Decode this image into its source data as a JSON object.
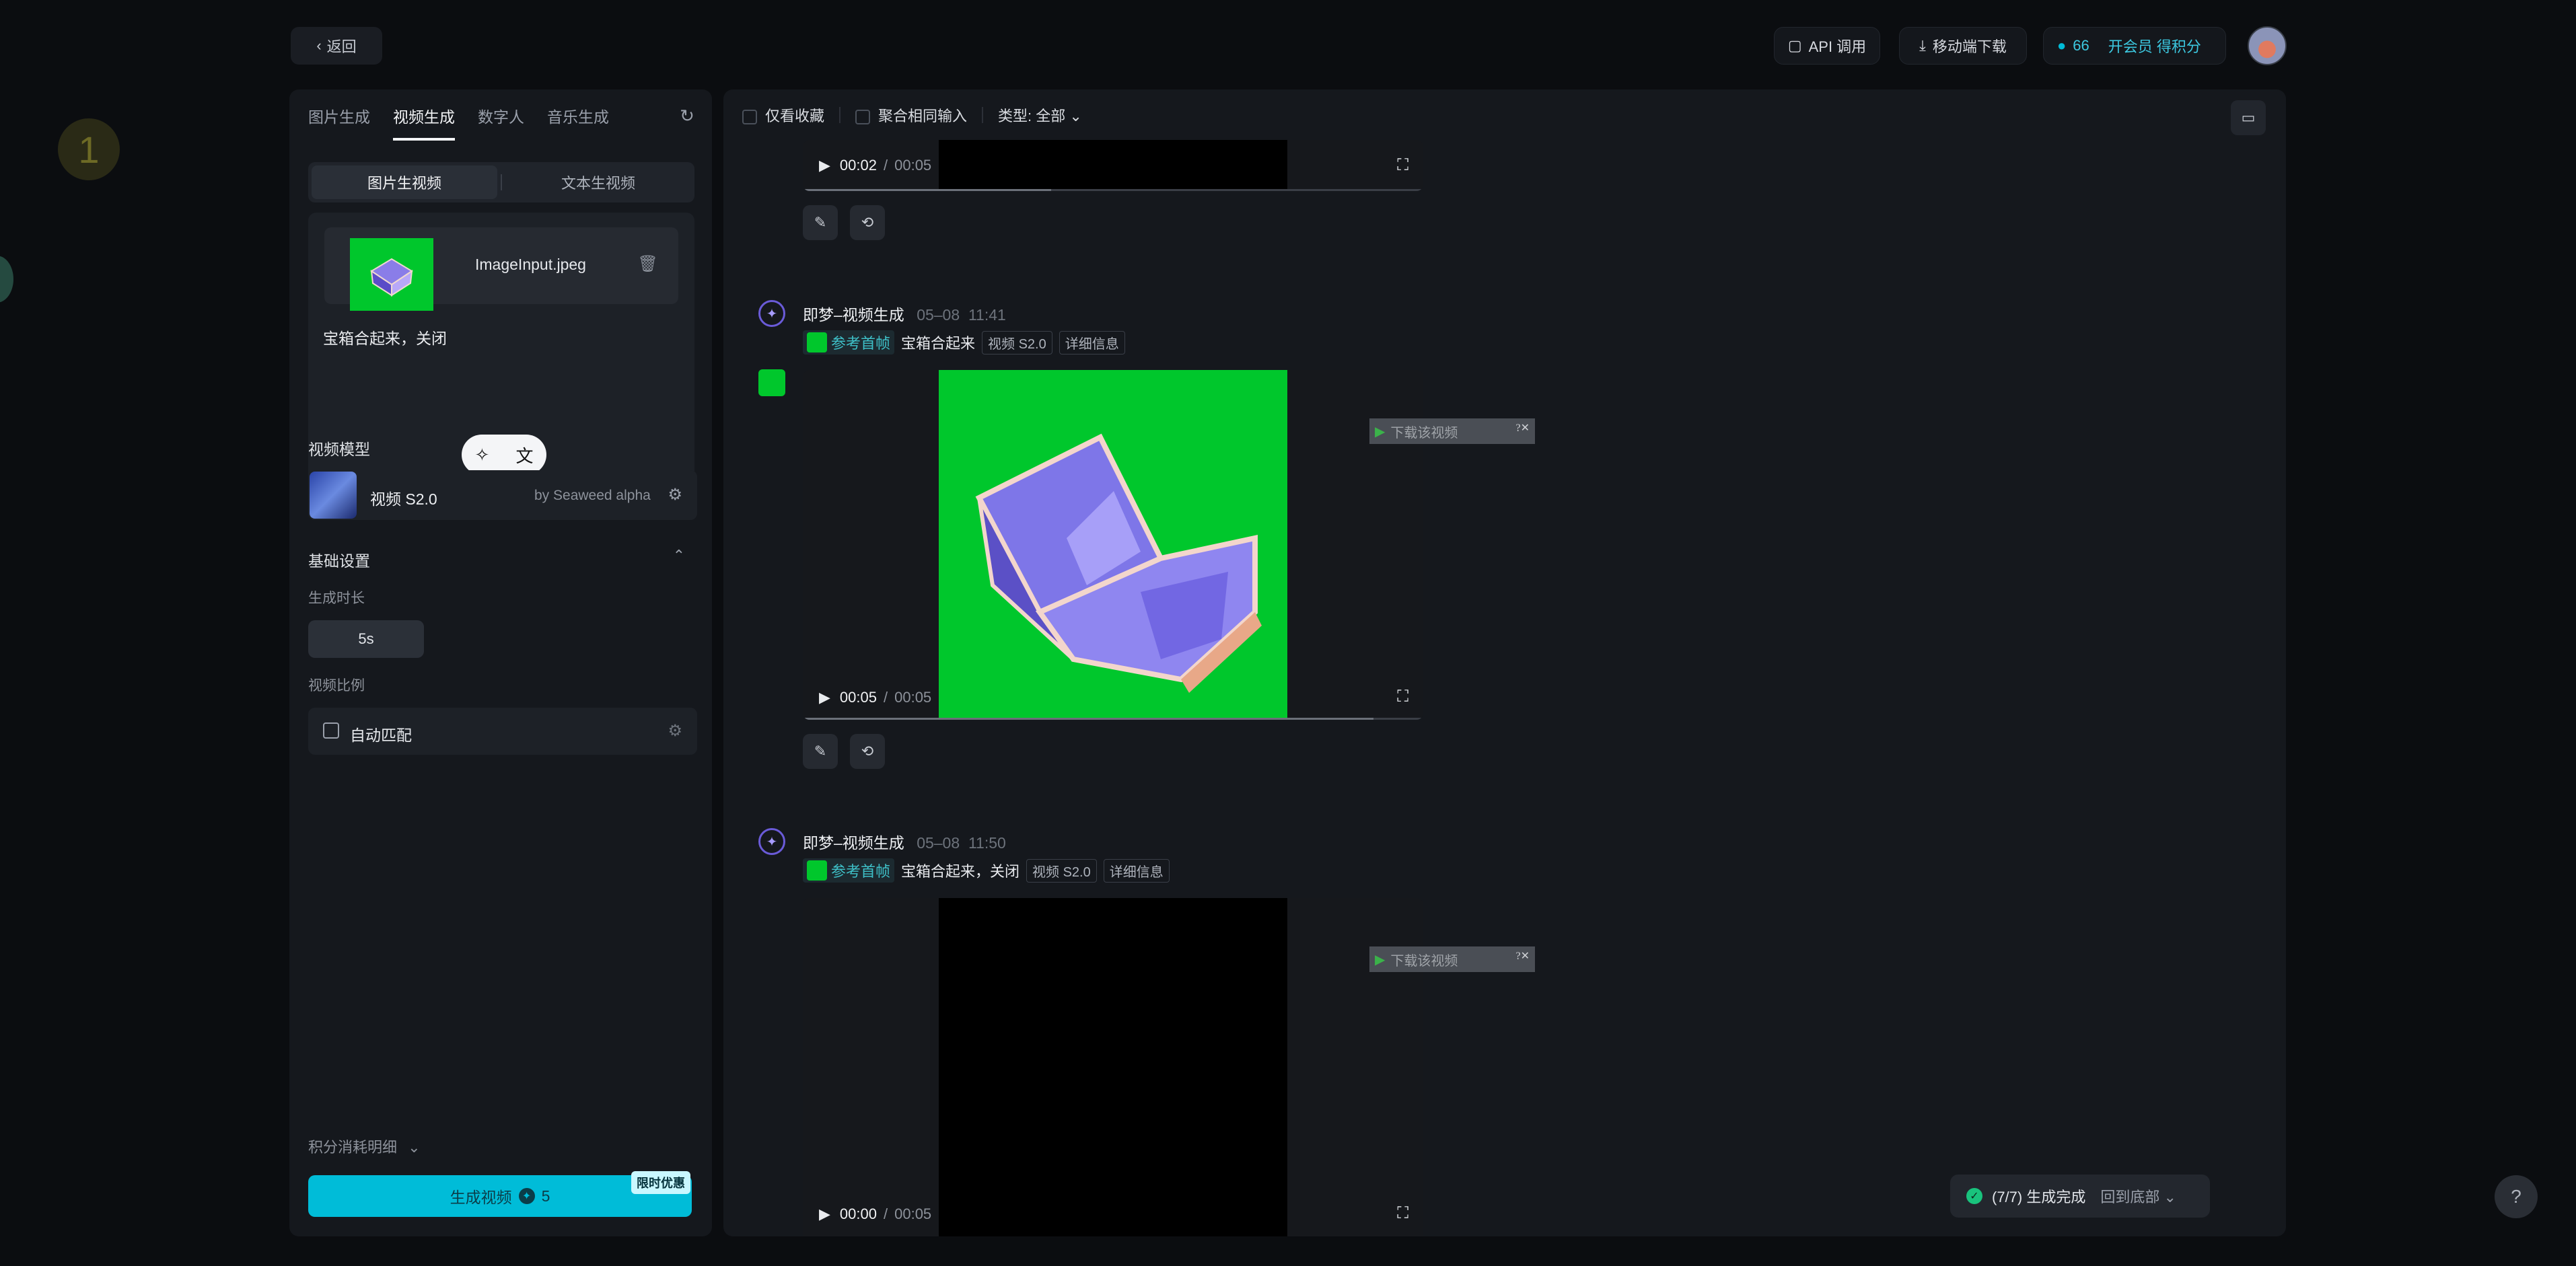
{
  "header": {
    "back_label": "返回",
    "api_label": "API 调用",
    "mobile_label": "移动端下载",
    "points": "66",
    "member_label": "开会员 得积分"
  },
  "deco": {
    "step_number": "1"
  },
  "left": {
    "tabs": [
      "图片生成",
      "视频生成",
      "数字人",
      "音乐生成"
    ],
    "active_tab": 1,
    "mode": {
      "image_to_video": "图片生视频",
      "text_to_video": "文本生视频"
    },
    "upload": {
      "file_name": "ImageInput.jpeg"
    },
    "prompt_text": "宝箱合起来，关闭",
    "model_section": "视频模型",
    "model": {
      "name": "视频 S2.0",
      "by": "by Seaweed alpha"
    },
    "basic_settings": "基础设置",
    "duration_label": "生成时长",
    "duration_value": "5s",
    "ratio_label": "视频比例",
    "ratio_value": "自动匹配",
    "cost_detail": "积分消耗明细",
    "generate": {
      "label": "生成视频",
      "cost": "5",
      "promo": "限时优惠"
    }
  },
  "right": {
    "filters": {
      "favorites": "仅看收藏",
      "aggregate": "聚合相同输入",
      "type": "类型: 全部"
    },
    "items": [
      {
        "time_current": "00:02",
        "time_total": "00:05",
        "progress": 0.4
      },
      {
        "source": "即梦–视频生成",
        "date": "05–08",
        "time": "11:41",
        "ref_label": "参考首帧",
        "prompt": "宝箱合起来",
        "model_chip": "视频 S2.0",
        "detail_chip": "详细信息",
        "time_current": "00:05",
        "time_total": "00:05",
        "progress": 0.92,
        "overlay": "下载该视频"
      },
      {
        "source": "即梦–视频生成",
        "date": "05–08",
        "time": "11:50",
        "ref_label": "参考首帧",
        "prompt": "宝箱合起来，关闭",
        "model_chip": "视频 S2.0",
        "detail_chip": "详细信息",
        "time_current": "00:00",
        "time_total": "00:05",
        "progress": 0,
        "overlay": "下载该视频"
      }
    ],
    "status": {
      "text": "(7/7) 生成完成",
      "link": "回到底部"
    },
    "help": "?"
  },
  "colors": {
    "accent": "#00bcd8",
    "green_screen": "#00c72c",
    "brand_purple": "#6a5bd8"
  }
}
